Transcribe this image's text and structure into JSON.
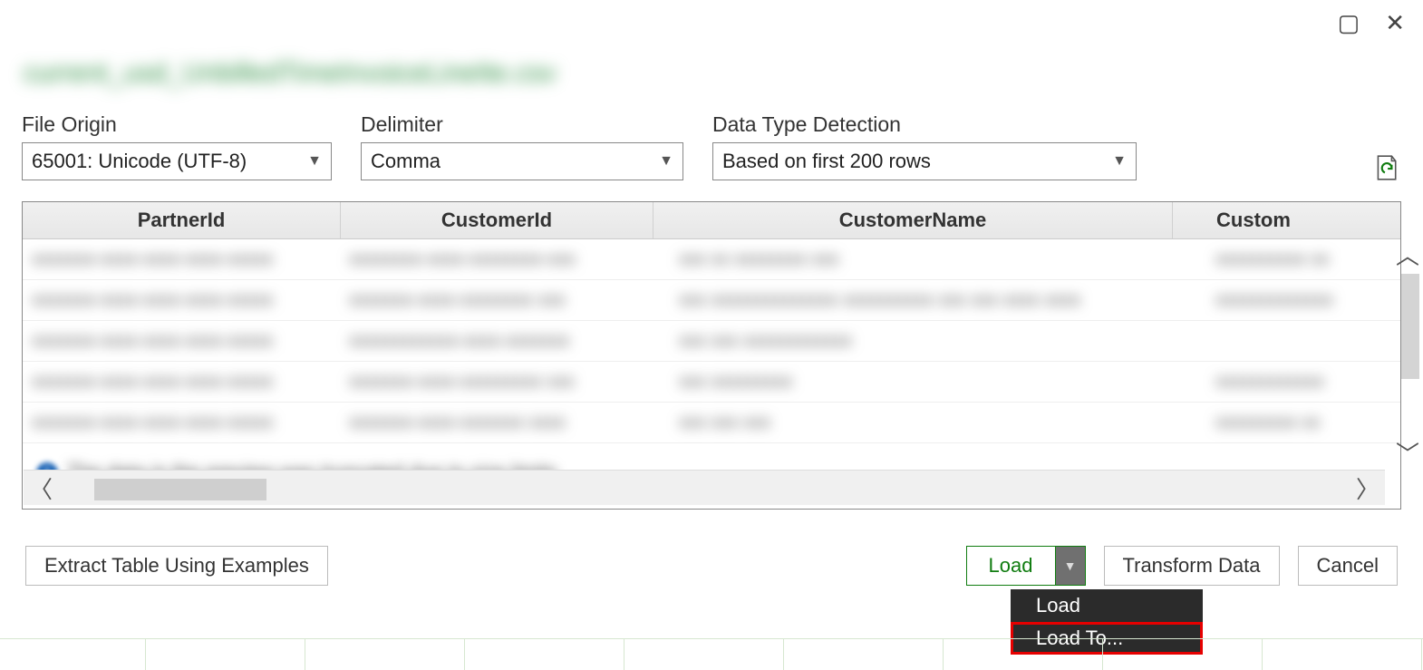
{
  "window": {
    "filename": "current_usd_UnbilledTimeInvoiceLineIte.csv"
  },
  "options": {
    "file_origin_label": "File Origin",
    "file_origin_value": "65001: Unicode (UTF-8)",
    "delimiter_label": "Delimiter",
    "delimiter_value": "Comma",
    "detection_label": "Data Type Detection",
    "detection_value": "Based on first 200 rows"
  },
  "table": {
    "headers": {
      "c1": "PartnerId",
      "c2": "CustomerId",
      "c3": "CustomerName",
      "c4": "Custom"
    },
    "info_text": "The data in the preview was truncated due to size limits"
  },
  "footer": {
    "extract_label": "Extract Table Using Examples",
    "load_label": "Load",
    "transform_label": "Transform Data",
    "cancel_label": "Cancel"
  },
  "load_menu": {
    "item1": "Load",
    "item2": "Load To..."
  }
}
